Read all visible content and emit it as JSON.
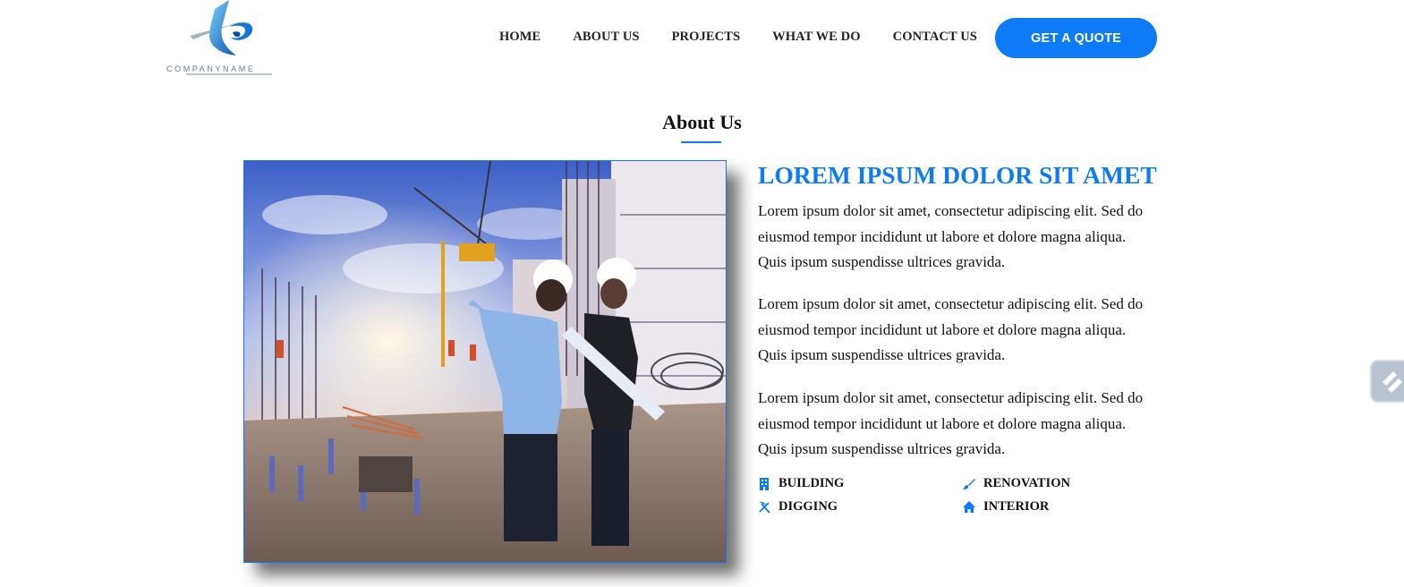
{
  "header": {
    "logo": {
      "icon": "company-logo-icon",
      "text": "COMPANYNAME"
    },
    "nav": [
      {
        "label": "HOME"
      },
      {
        "label": "ABOUT US"
      },
      {
        "label": "PROJECTS"
      },
      {
        "label": "WHAT WE DO"
      },
      {
        "label": "CONTACT US"
      }
    ],
    "cta_label": "GET A QUOTE"
  },
  "about": {
    "title": "About Us",
    "image_alt_icon": "construction-site-photo",
    "headline": "LOREM IPSUM DOLOR SIT AMET",
    "paragraphs": [
      "Lorem ipsum dolor sit amet, consectetur adipiscing elit. Sed do eiusmod tempor incididunt ut labore et dolore magna aliqua. Quis ipsum suspendisse ultrices gravida.",
      "Lorem ipsum dolor sit amet, consectetur adipiscing elit. Sed do eiusmod tempor incididunt ut labore et dolore magna aliqua. Quis ipsum suspendisse ultrices gravida.",
      "Lorem ipsum dolor sit amet, consectetur adipiscing elit. Sed do eiusmod tempor incididunt ut labore et dolore magna aliqua. Quis ipsum suspendisse ultrices gravida."
    ],
    "features": [
      {
        "label": "BUILDING",
        "icon": "building-icon"
      },
      {
        "label": "RENOVATION",
        "icon": "paint-brush-icon"
      },
      {
        "label": "DIGGING",
        "icon": "hammer-pick-icon"
      },
      {
        "label": "INTERIOR",
        "icon": "home-icon"
      }
    ]
  },
  "colors": {
    "accent": "#0d7bf5",
    "text": "#111111",
    "background": "#ffffff"
  }
}
